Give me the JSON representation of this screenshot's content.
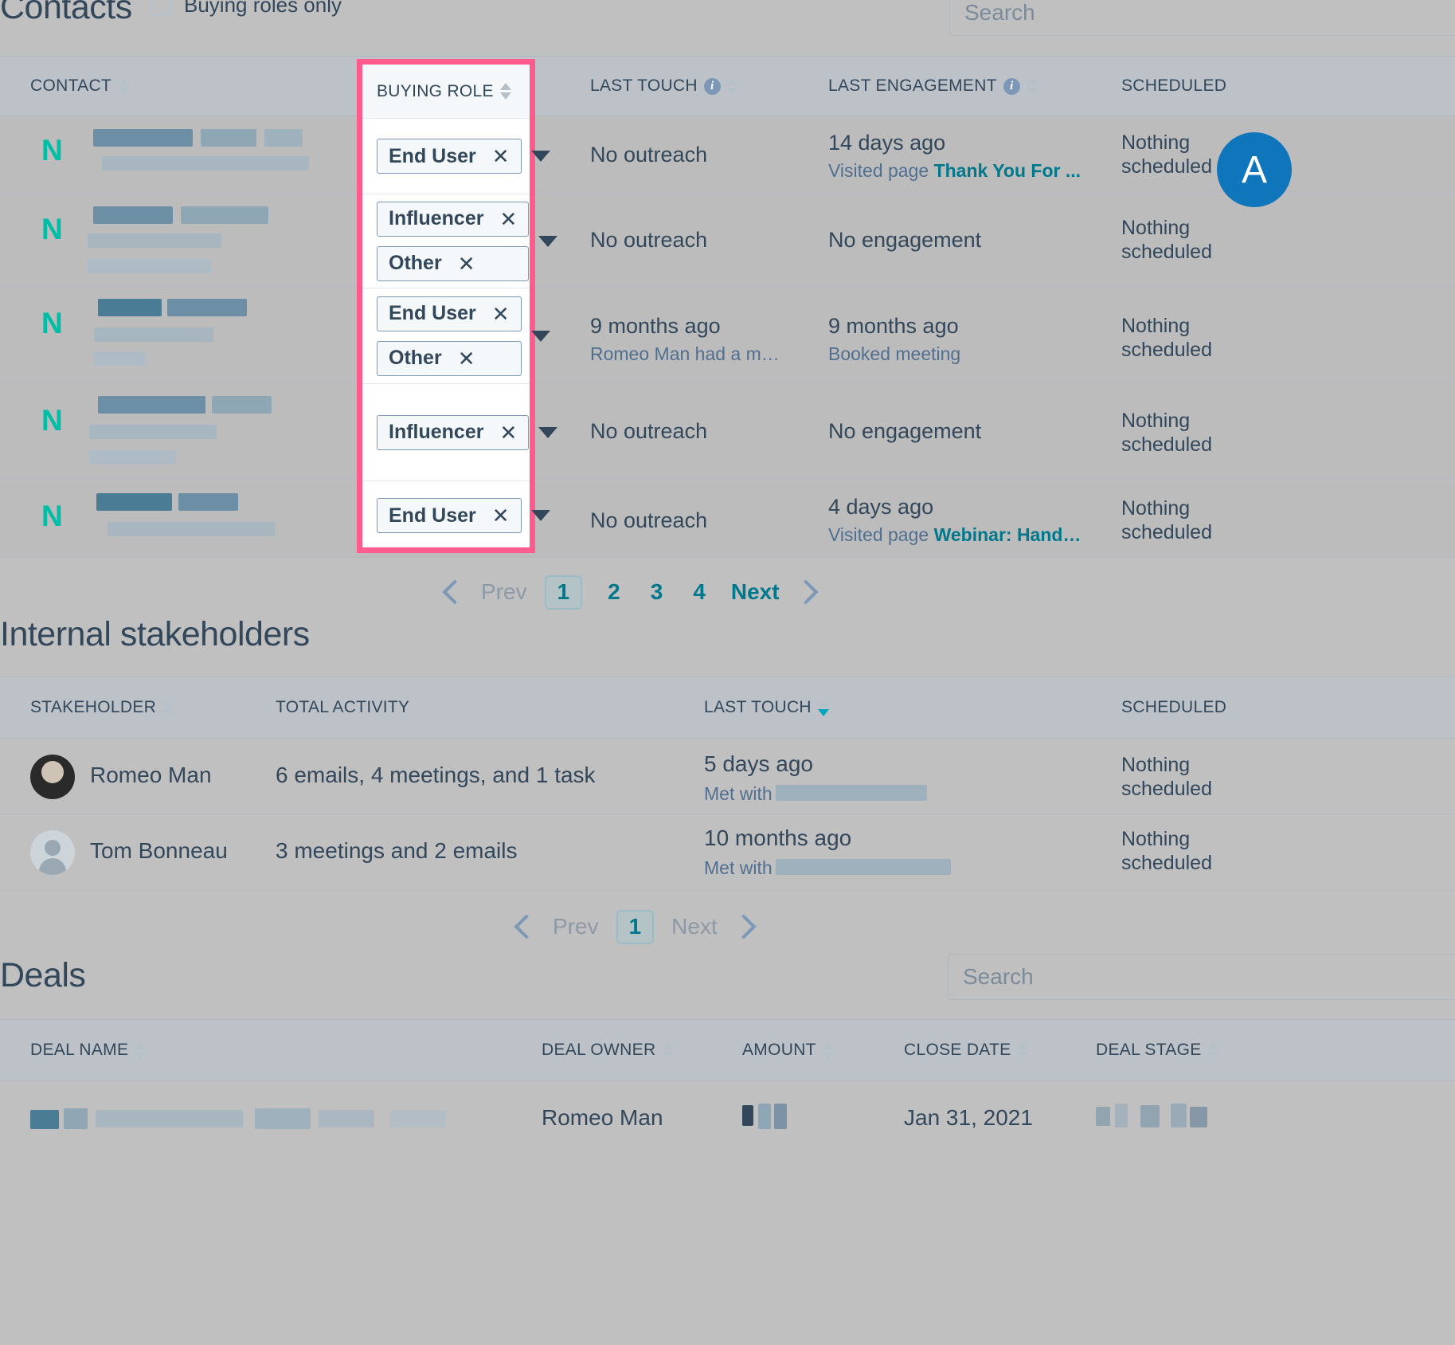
{
  "contacts": {
    "title": "Contacts",
    "filter_label": "Buying roles only",
    "filter_checked": false,
    "search_placeholder": "Search",
    "columns": [
      {
        "label": "CONTACT",
        "sortable": true
      },
      {
        "label": "BUYING ROLE",
        "sortable": true
      },
      {
        "label": "LAST TOUCH",
        "sortable": true,
        "info": true
      },
      {
        "label": "LAST ENGAGEMENT",
        "sortable": true,
        "info": true
      },
      {
        "label": "SCHEDULED",
        "sortable": false
      }
    ],
    "rows": [
      {
        "buying_roles": [
          "End User"
        ],
        "last_touch": "No outreach",
        "last_touch_sub": "",
        "last_engagement": "14 days ago",
        "last_engagement_sub_prefix": "Visited page ",
        "last_engagement_sub_link": "Thank You For ...",
        "scheduled": "Nothing scheduled"
      },
      {
        "buying_roles": [
          "Influencer",
          "Other"
        ],
        "last_touch": "No outreach",
        "last_touch_sub": "",
        "last_engagement": "No engagement",
        "last_engagement_sub_prefix": "",
        "last_engagement_sub_link": "",
        "scheduled": "Nothing scheduled"
      },
      {
        "buying_roles": [
          "End User",
          "Other"
        ],
        "last_touch": "9 months ago",
        "last_touch_sub": "Romeo Man had a m…",
        "last_engagement": "9 months ago",
        "last_engagement_sub_prefix": "Booked meeting",
        "last_engagement_sub_link": "",
        "scheduled": "Nothing scheduled"
      },
      {
        "buying_roles": [
          "Influencer"
        ],
        "last_touch": "No outreach",
        "last_touch_sub": "",
        "last_engagement": "No engagement",
        "last_engagement_sub_prefix": "",
        "last_engagement_sub_link": "",
        "scheduled": "Nothing scheduled"
      },
      {
        "buying_roles": [
          "End User"
        ],
        "last_touch": "No outreach",
        "last_touch_sub": "",
        "last_engagement": "4 days ago",
        "last_engagement_sub_prefix": "Visited page ",
        "last_engagement_sub_link": "Webinar: Hand…",
        "scheduled": "Nothing scheduled"
      }
    ],
    "pagination": {
      "prev": "Prev",
      "pages": [
        "1",
        "2",
        "3",
        "4"
      ],
      "current": "1",
      "next": "Next"
    },
    "avatar_initial": "A"
  },
  "stakeholders": {
    "title": "Internal stakeholders",
    "columns": [
      {
        "label": "STAKEHOLDER",
        "sortable": true
      },
      {
        "label": "TOTAL ACTIVITY",
        "sortable": false
      },
      {
        "label": "LAST TOUCH",
        "sortable": true,
        "sort_active": "desc"
      },
      {
        "label": "SCHEDULED",
        "sortable": false
      }
    ],
    "rows": [
      {
        "name": "Romeo Man",
        "avatar_type": "photo",
        "total_activity": "6 emails, 4 meetings, and 1 task",
        "last_touch": "5 days ago",
        "last_touch_sub": "Met with",
        "scheduled": "Nothing scheduled"
      },
      {
        "name": "Tom Bonneau",
        "avatar_type": "placeholder",
        "total_activity": "3 meetings and 2 emails",
        "last_touch": "10 months ago",
        "last_touch_sub": "Met with",
        "scheduled": "Nothing scheduled"
      }
    ],
    "pagination": {
      "prev": "Prev",
      "pages": [
        "1"
      ],
      "current": "1",
      "next": "Next"
    }
  },
  "deals": {
    "title": "Deals",
    "search_placeholder": "Search",
    "columns": [
      {
        "label": "DEAL NAME",
        "sortable": true
      },
      {
        "label": "DEAL OWNER",
        "sortable": true
      },
      {
        "label": "AMOUNT",
        "sortable": true
      },
      {
        "label": "CLOSE DATE",
        "sortable": true
      },
      {
        "label": "DEAL STAGE",
        "sortable": true
      }
    ],
    "rows": [
      {
        "deal_name": "",
        "deal_owner": "Romeo Man",
        "amount": "",
        "close_date": "Jan 31, 2021",
        "deal_stage": ""
      }
    ]
  },
  "icons": {
    "search": "search-icon",
    "sort": "sort-icon",
    "info": "info-icon",
    "chevron_left": "chevron-left-icon",
    "chevron_right": "chevron-right-icon",
    "caret_down": "caret-down-icon",
    "close": "close-icon",
    "logo": "netline-logo-icon"
  },
  "colors": {
    "highlight": "#ff5c8d",
    "link": "#00788c",
    "text": "#33475b",
    "secondary_text": "#516f90",
    "accent_teal": "#00a4bd",
    "logo_green": "#00bda5",
    "page_bg": "#c0c0c0",
    "header_bg": "#bcc2c7"
  }
}
